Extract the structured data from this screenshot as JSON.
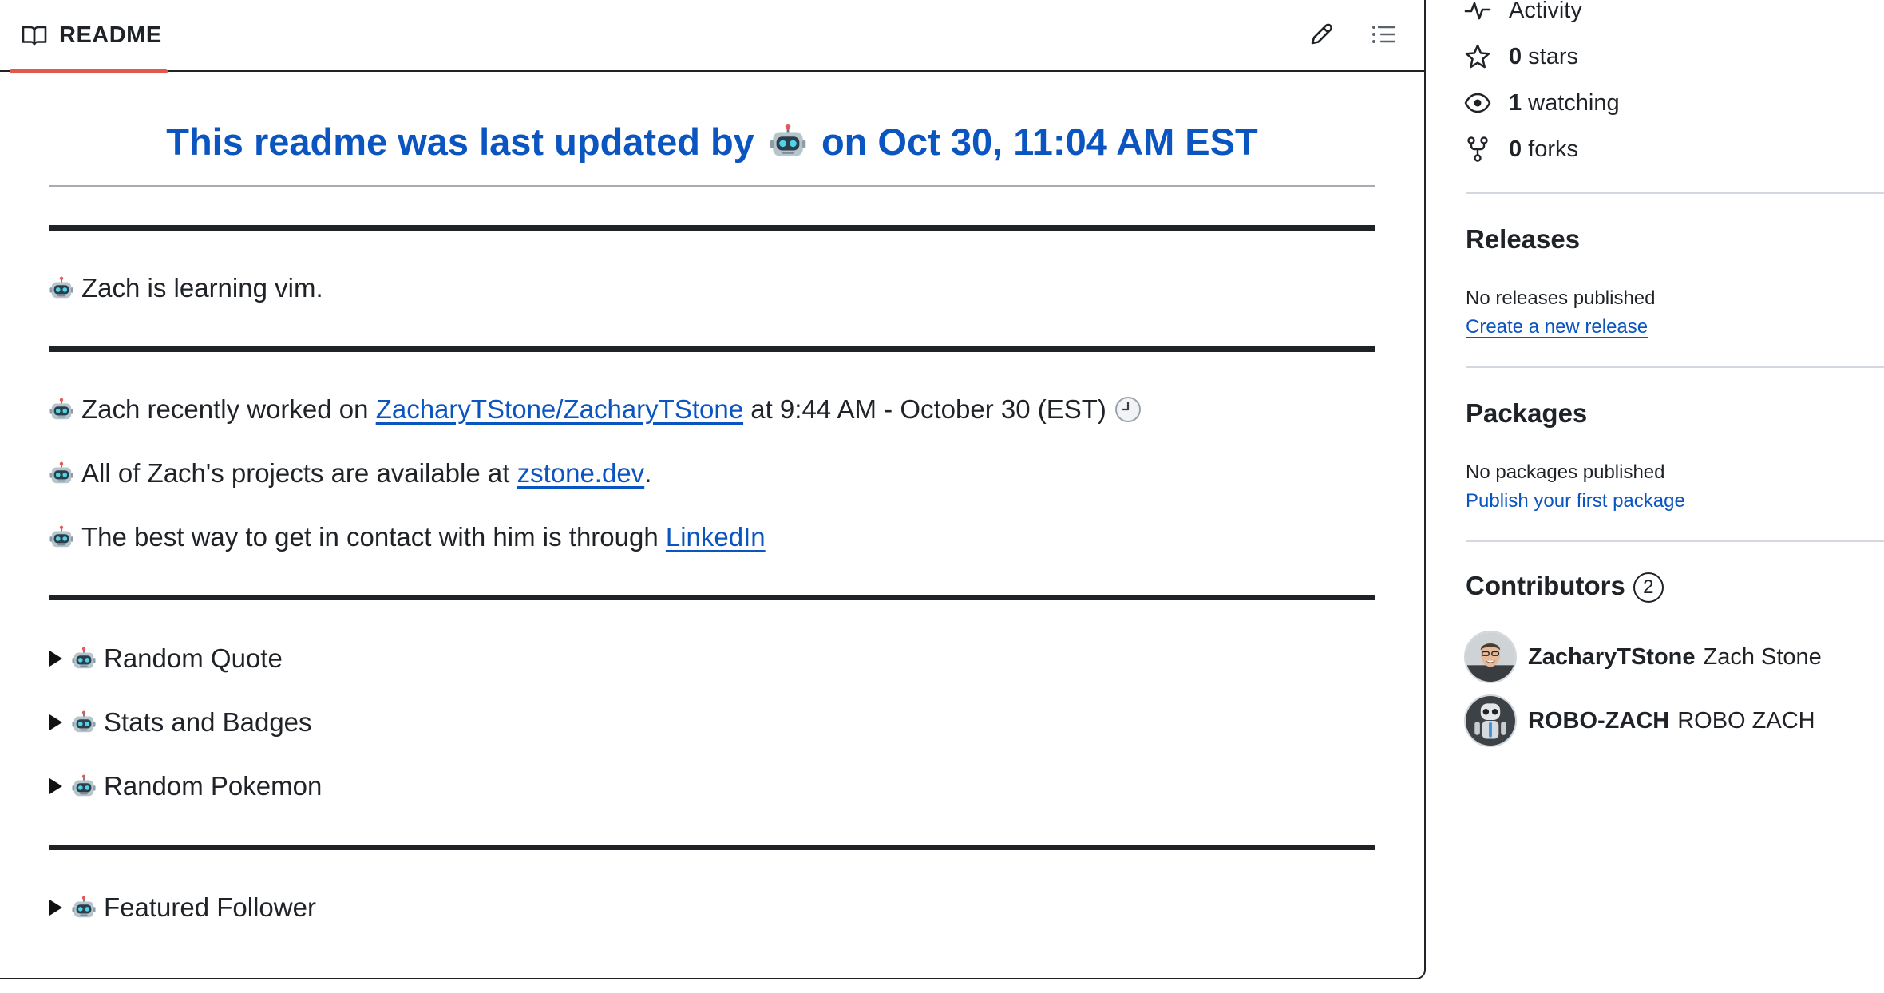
{
  "readme": {
    "tab_label": "README",
    "title": "This readme was last updated by 🤖 on Oct 30, 11:04 AM EST",
    "title_prefix": "This readme was last updated by",
    "title_suffix": "on Oct 30, 11:04 AM EST",
    "learning": "Zach is learning vim.",
    "recent_prefix": "Zach recently worked on",
    "recent_repo": "ZacharyTStone/ZacharyTStone",
    "recent_suffix": "at 9:44 AM - October 30 (EST)",
    "projects_prefix": "All of Zach's projects are available at",
    "projects_link": "zstone.dev",
    "projects_suffix": ".",
    "contact_prefix": "The best way to get in contact with him is through",
    "contact_link": "LinkedIn",
    "details": [
      "Random Quote",
      "Stats and Badges",
      "Random Pokemon"
    ],
    "featured": "Featured Follower"
  },
  "sidebar": {
    "activity": "Activity",
    "stars_count": "0",
    "stars_label": "stars",
    "watching_count": "1",
    "watching_label": "watching",
    "forks_count": "0",
    "forks_label": "forks",
    "releases": {
      "heading": "Releases",
      "text": "No releases published",
      "link": "Create a new release"
    },
    "packages": {
      "heading": "Packages",
      "text": "No packages published",
      "link": "Publish your first package"
    },
    "contributors": {
      "heading": "Contributors",
      "count": "2",
      "list": [
        {
          "login": "ZacharyTStone",
          "name": "Zach Stone"
        },
        {
          "login": "ROBO-ZACH",
          "name": "ROBO ZACH"
        }
      ]
    }
  },
  "colors": {
    "link": "#0b55c0",
    "tab_underline": "#e2584d",
    "text": "#1f2328"
  }
}
